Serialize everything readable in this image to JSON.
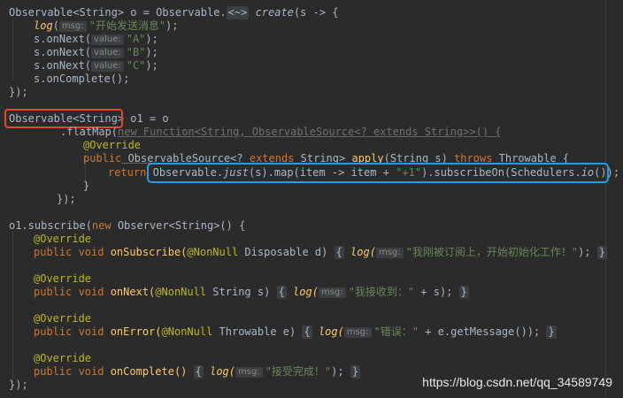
{
  "code": {
    "l1": {
      "a": "Observable<String> o = Observable.",
      "fold": "<~>",
      "b": " ",
      "create": "create",
      "c": "(s -> {"
    },
    "l2": {
      "log": "log",
      "hint": "msg:",
      "str": "\"开始发送消息\"",
      "end": ");"
    },
    "l3": {
      "a": "s.onNext(",
      "hint": "value:",
      "str": "\"A\"",
      "end": ");"
    },
    "l4": {
      "a": "s.onNext(",
      "hint": "value:",
      "str": "\"B\"",
      "end": ");"
    },
    "l5": {
      "a": "s.onNext(",
      "hint": "value:",
      "str": "\"C\"",
      "end": ");"
    },
    "l6": {
      "a": "s.onComplete();"
    },
    "l7": {
      "a": "});"
    },
    "l8": {
      "boxed": "Observable<String>",
      "rest": " o1 = o"
    },
    "l9": {
      "a": ".flatMap(",
      "dim": "new Function<String, ObservableSource<? extends String>>() {"
    },
    "l10": {
      "ann": "@Override"
    },
    "l11": {
      "public": "public",
      "type": " ObservableSource<? ",
      "extends": "extends",
      "type2": " String> ",
      "apply": "apply",
      "args": "(String s) ",
      "throws": "throws",
      "thr": " Throwable {"
    },
    "l12": {
      "ret": "return",
      "a": "Observable.",
      "just": "just",
      "b": "(s).map(item -> item + ",
      "str": "\"+1\"",
      "c": ").subscribeOn(Schedulers.",
      "io": "io",
      "d": "());"
    },
    "l13": {
      "a": "}"
    },
    "l14": {
      "a": "});"
    },
    "l15": {
      "a": "o1.subscribe(",
      "new": "new",
      "b": " Observer<String>() {"
    },
    "l16": {
      "ann": "@Override"
    },
    "l17": {
      "pv": "public void",
      "name": " onSubscribe(",
      "nn": "@NonNull",
      "b": " Disposable d) ",
      "ob": "{",
      "log": "log(",
      "hint": "msg:",
      "str": "\"我刚被订阅上，开始初始化工作！\"",
      "end": "); ",
      "cb": "}"
    },
    "l18": {
      "ann": "@Override"
    },
    "l19": {
      "pv": "public void",
      "name": " onNext(",
      "nn": "@NonNull",
      "b": " String s) ",
      "ob": "{",
      "log": "log(",
      "hint": "msg:",
      "str": "\"我接收到：\"",
      "end": " + s); ",
      "cb": "}"
    },
    "l20": {
      "ann": "@Override"
    },
    "l21": {
      "pv": "public void",
      "name": " onError(",
      "nn": "@NonNull",
      "b": " Throwable e) ",
      "ob": "{",
      "log": "log(",
      "hint": "msg:",
      "str": "\"错误：\"",
      "end": " + e.getMessage()); ",
      "cb": "}"
    },
    "l22": {
      "ann": "@Override"
    },
    "l23": {
      "pv": "public void",
      "name": " onComplete() ",
      "ob": "{",
      "log": "log(",
      "hint": "msg:",
      "str": "\"接受完成！\"",
      "end": "); ",
      "cb": "}"
    },
    "l24": {
      "a": "});"
    }
  },
  "watermark": "https://blog.csdn.net/qq_34589749",
  "colors": {
    "background": "#2b2b2b",
    "keyword": "#cc7832",
    "string": "#6a8759",
    "annotation": "#bbb529",
    "default_text": "#a9b7c6",
    "red_highlight": "#e8452c",
    "blue_highlight": "#2a9be0"
  }
}
